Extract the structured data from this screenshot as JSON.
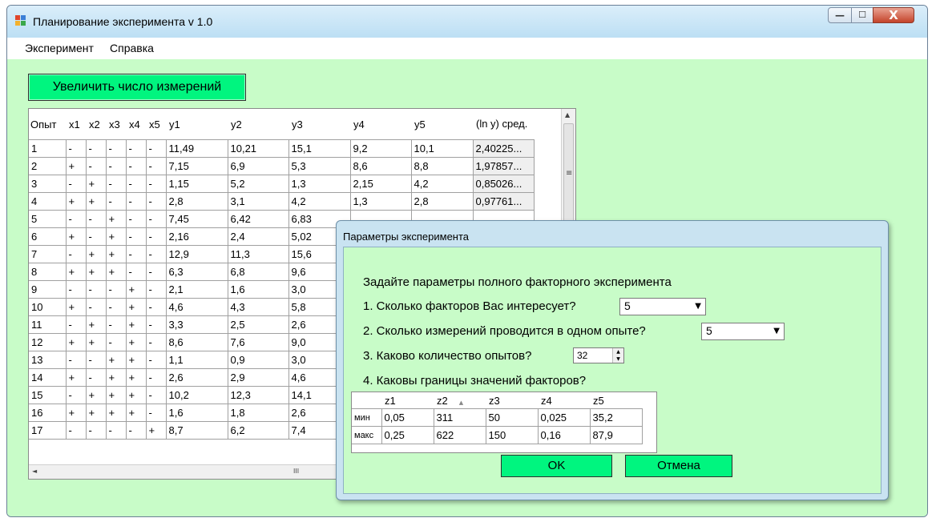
{
  "window": {
    "title": "Планирование эксперимента v 1.0",
    "controls": {
      "minimize": "—",
      "maximize": "☐",
      "close": "X"
    },
    "titlebar_color": "#c6e9f3",
    "client_color": "#c8fcc8",
    "button_color": "#00f57f"
  },
  "menu": [
    "Эксперимент",
    "Справка"
  ],
  "increase_button": "Увеличить число измерений",
  "grid": {
    "columns": [
      "Опыт",
      "x1",
      "x2",
      "x3",
      "x4",
      "x5",
      "y1",
      "y2",
      "y3",
      "y4",
      "y5",
      "(ln y) сред."
    ],
    "rows": [
      [
        "1",
        "-",
        "-",
        "-",
        "-",
        "-",
        "11,49",
        "10,21",
        "15,1",
        "9,2",
        "10,1",
        "2,40225..."
      ],
      [
        "2",
        "+",
        "-",
        "-",
        "-",
        "-",
        "7,15",
        "6,9",
        "5,3",
        "8,6",
        "8,8",
        "1,97857..."
      ],
      [
        "3",
        "-",
        "+",
        "-",
        "-",
        "-",
        "1,15",
        "5,2",
        "1,3",
        "2,15",
        "4,2",
        "0,85026..."
      ],
      [
        "4",
        "+",
        "+",
        "-",
        "-",
        "-",
        "2,8",
        "3,1",
        "4,2",
        "1,3",
        "2,8",
        "0,97761..."
      ],
      [
        "5",
        "-",
        "-",
        "+",
        "-",
        "-",
        "7,45",
        "6,42",
        "6,83",
        "",
        "",
        ""
      ],
      [
        "6",
        "+",
        "-",
        "+",
        "-",
        "-",
        "2,16",
        "2,4",
        "5,02",
        "",
        "",
        ""
      ],
      [
        "7",
        "-",
        "+",
        "+",
        "-",
        "-",
        "12,9",
        "11,3",
        "15,6",
        "",
        "",
        ""
      ],
      [
        "8",
        "+",
        "+",
        "+",
        "-",
        "-",
        "6,3",
        "6,8",
        "9,6",
        "",
        "",
        ""
      ],
      [
        "9",
        "-",
        "-",
        "-",
        "+",
        "-",
        "2,1",
        "1,6",
        "3,0",
        "",
        "",
        ""
      ],
      [
        "10",
        "+",
        "-",
        "-",
        "+",
        "-",
        "4,6",
        "4,3",
        "5,8",
        "",
        "",
        ""
      ],
      [
        "11",
        "-",
        "+",
        "-",
        "+",
        "-",
        "3,3",
        "2,5",
        "2,6",
        "",
        "",
        ""
      ],
      [
        "12",
        "+",
        "+",
        "-",
        "+",
        "-",
        "8,6",
        "7,6",
        "9,0",
        "",
        "",
        ""
      ],
      [
        "13",
        "-",
        "-",
        "+",
        "+",
        "-",
        "1,1",
        "0,9",
        "3,0",
        "",
        "",
        ""
      ],
      [
        "14",
        "+",
        "-",
        "+",
        "+",
        "-",
        "2,6",
        "2,9",
        "4,6",
        "",
        "",
        ""
      ],
      [
        "15",
        "-",
        "+",
        "+",
        "+",
        "-",
        "10,2",
        "12,3",
        "14,1",
        "",
        "",
        ""
      ],
      [
        "16",
        "+",
        "+",
        "+",
        "+",
        "-",
        "1,6",
        "1,8",
        "2,6",
        "",
        "",
        ""
      ],
      [
        "17",
        "-",
        "-",
        "-",
        "-",
        "+",
        "8,7",
        "6,2",
        "7,4",
        "",
        "",
        ""
      ]
    ],
    "scroll_up": "▲",
    "scroll_left": "◄",
    "scroll_thumb": "≡",
    "hscroll_thumb": "III"
  },
  "dialog": {
    "title": "Параметры эксперимента",
    "heading": "Задайте параметры полного факторного эксперимента",
    "q1": "1. Сколько факторов Вас интересует?",
    "q1_value": "5",
    "q2": "2. Сколько измерений проводится в одном опыте?",
    "q2_value": "5",
    "q3": "3. Каково количество опытов?",
    "q3_value": "32",
    "q4": "4. Каковы границы значений факторов?",
    "dropdown_arrow": "▼",
    "spin_up": "▲",
    "spin_down": "▼",
    "limits": {
      "columns": [
        "",
        "z1",
        "z2",
        "z3",
        "z4",
        "z5"
      ],
      "sort_glyph": "▲",
      "rows": [
        [
          "мин",
          "0,05",
          "311",
          "50",
          "0,025",
          "35,2"
        ],
        [
          "макс",
          "0,25",
          "622",
          "150",
          "0,16",
          "87,9"
        ]
      ]
    },
    "ok": "OK",
    "cancel": "Отмена"
  }
}
